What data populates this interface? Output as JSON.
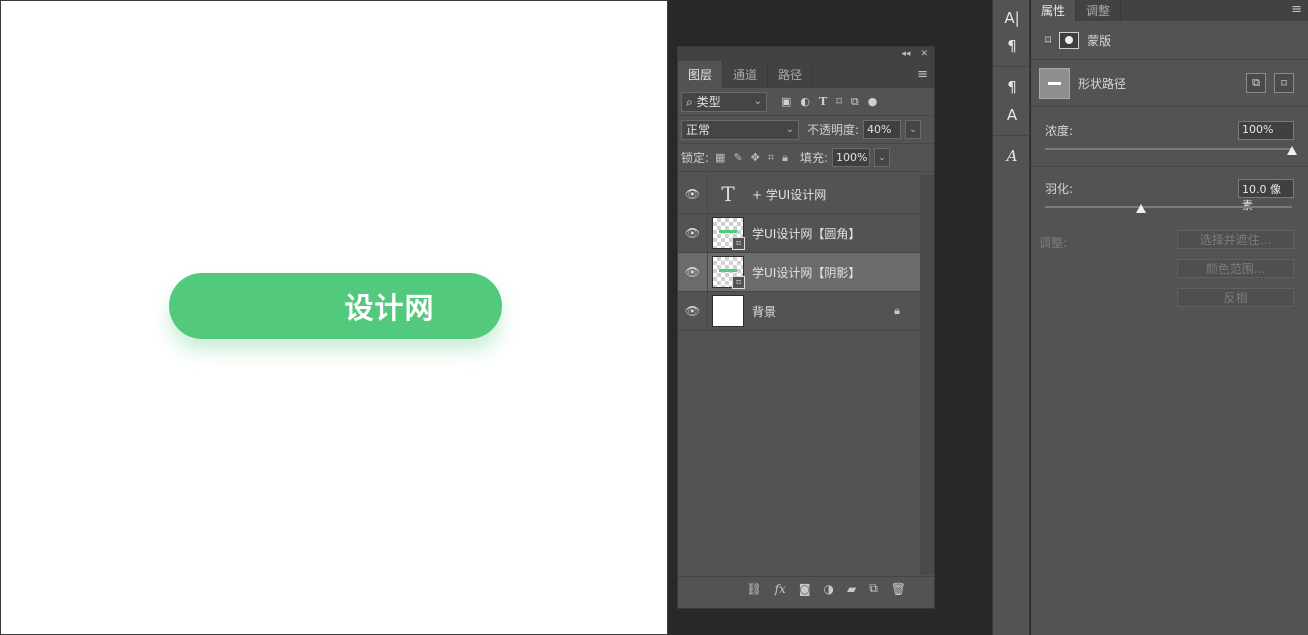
{
  "canvas": {
    "button_text": "设计网",
    "button_color": "#52c97c"
  },
  "layers_panel": {
    "tabs": [
      "图层",
      "通道",
      "路径"
    ],
    "filter_kind": "类型",
    "blend_mode": "正常",
    "opacity_label": "不透明度:",
    "opacity_value": "40%",
    "lock_label": "锁定:",
    "fill_label": "填充:",
    "fill_value": "100%",
    "layers": [
      {
        "name": "+ 学UI设计网",
        "type": "text",
        "visible": true,
        "selected": false
      },
      {
        "name": "学UI设计网【圆角】",
        "type": "shape",
        "visible": true,
        "selected": false
      },
      {
        "name": "学UI设计网【阴影】",
        "type": "shape",
        "visible": true,
        "selected": true
      },
      {
        "name": "背景",
        "type": "background",
        "visible": true,
        "selected": false,
        "locked": true
      }
    ],
    "icons": [
      "eye-icon",
      "lock-icon",
      "link-icon",
      "fx-icon",
      "mask-icon",
      "adjustment-icon",
      "folder-icon",
      "new-layer-icon",
      "trash-icon"
    ]
  },
  "properties_panel": {
    "tabs": [
      "属性",
      "调整"
    ],
    "mask_label": "蒙版",
    "shape_label": "形状路径",
    "density_label": "浓度:",
    "density_value": "100%",
    "density_fraction": 1.0,
    "feather_label": "羽化:",
    "feather_value": "10.0 像素",
    "feather_fraction": 0.39,
    "refine_label": "调整:",
    "buttons": [
      "选择并遮住...",
      "颜色范围...",
      "反相"
    ]
  }
}
